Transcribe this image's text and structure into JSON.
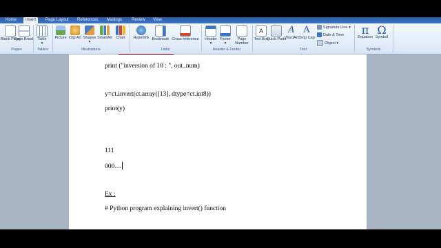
{
  "tabs": [
    "Home",
    "Insert",
    "Page Layout",
    "References",
    "Mailings",
    "Review",
    "View"
  ],
  "ribbon": {
    "pages": {
      "blank_page": "Blank Page",
      "page_break": "Page Break",
      "label": "Pages"
    },
    "tables": {
      "table": "Table",
      "label": "Tables"
    },
    "illustrations": {
      "picture": "Picture",
      "clip_art": "Clip Art",
      "shapes": "Shapes",
      "smartart": "SmartArt",
      "chart": "Chart",
      "label": "Illustrations"
    },
    "links": {
      "hyperlink": "Hyperlink",
      "bookmark": "Bookmark",
      "cross_reference": "Cross-reference",
      "label": "Links"
    },
    "header_footer": {
      "header": "Header",
      "footer": "Footer",
      "page_number": "Page Number",
      "label": "Header & Footer"
    },
    "text": {
      "text_box": "Text Box",
      "quick_parts": "Quick Parts",
      "wordart": "WordArt",
      "drop_cap": "Drop Cap",
      "signature_line": "Signature Line",
      "date_time": "Date & Time",
      "object": "Object",
      "label": "Text"
    },
    "symbols": {
      "equation": "Equation",
      "symbol": "Symbol",
      "pi": "π",
      "omega": "Ω",
      "label": "Symbols"
    }
  },
  "document": {
    "line1": "print (\"inversion of 10 : \", out_num)",
    "line2": "y=ct.invert(ct.array([13], dtype=ct.int8))",
    "line3": "print(y)",
    "line4": "111",
    "line5": "000…",
    "line6": "Ex :",
    "line7": "# Python program explaining invert() function"
  },
  "colors": {
    "tab_bar": "#2c5da8",
    "ribbon": "#dfe9f6",
    "canvas": "#a9b4c3",
    "page": "#ffffff",
    "accent": "#2458a8"
  }
}
